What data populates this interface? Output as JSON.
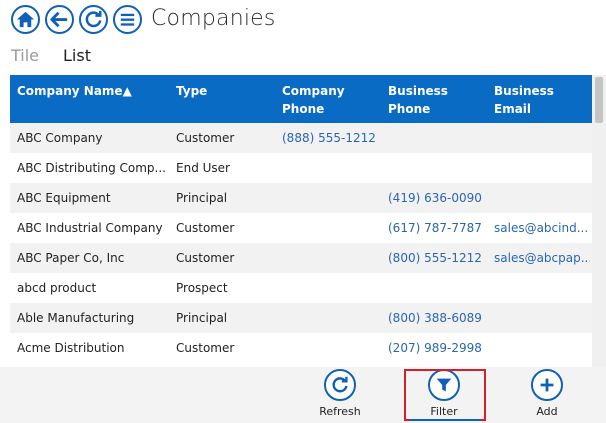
{
  "header": {
    "title": "Companies",
    "nav_icons": [
      "home-icon",
      "back-icon",
      "refresh-icon",
      "menu-icon"
    ]
  },
  "view_tabs": {
    "tile": "Tile",
    "list": "List",
    "active": "List"
  },
  "table": {
    "columns": {
      "company_name": "Company Name▲",
      "type": "Type",
      "company_phone_1": "Company",
      "company_phone_2": "Phone",
      "business_phone_1": "Business",
      "business_phone_2": "Phone",
      "business_email": "Business Email"
    },
    "rows": [
      {
        "name": "ABC Company",
        "type": "Customer",
        "company_phone": "(888) 555-1212",
        "business_phone": "",
        "email": ""
      },
      {
        "name": "ABC Distributing Comp...",
        "type": "End User",
        "company_phone": "",
        "business_phone": "",
        "email": ""
      },
      {
        "name": "ABC Equipment",
        "type": "Principal",
        "company_phone": "",
        "business_phone": "(419) 636-0090",
        "email": ""
      },
      {
        "name": "ABC Industrial Company",
        "type": "Customer",
        "company_phone": "",
        "business_phone": "(617) 787-7787",
        "email": "sales@abcind..."
      },
      {
        "name": "ABC Paper Co, Inc",
        "type": "Customer",
        "company_phone": "",
        "business_phone": "(800) 555-1212",
        "email": "sales@abcpap..."
      },
      {
        "name": "abcd product",
        "type": "Prospect",
        "company_phone": "",
        "business_phone": "",
        "email": ""
      },
      {
        "name": "Able Manufacturing",
        "type": "Principal",
        "company_phone": "",
        "business_phone": "(800) 388-6089",
        "email": ""
      },
      {
        "name": "Acme Distribution",
        "type": "Customer",
        "company_phone": "",
        "business_phone": "(207) 989-2998",
        "email": ""
      }
    ]
  },
  "app_bar": {
    "refresh_label": "Refresh",
    "filter_label": "Filter",
    "add_label": "Add",
    "highlighted": "Filter"
  },
  "colors": {
    "accent": "#1160b8",
    "header_bg": "#0a6bc4",
    "link": "#2a66b0",
    "highlight_border": "#d0202a",
    "alt_row": "#f2f2f2"
  }
}
